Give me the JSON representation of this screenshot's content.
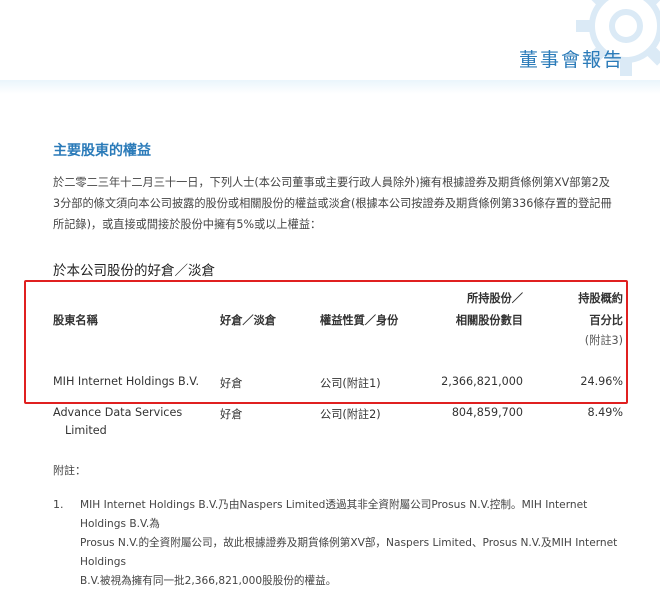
{
  "header": {
    "title": "董事會報告"
  },
  "section": {
    "title": "主要股東的權益",
    "intro_lines": [
      "於二零二三年十二月三十一日，下列人士(本公司董事或主要行政人員除外)擁有根據證券及期貨條例第XV部第2及",
      "3分部的條文須向本公司披露的股份或相關股份的權益或淡倉(根據本公司按證券及期貨條例第336條存置的登記冊",
      "所記錄)，或直接或間接於股份中擁有5%或以上權益："
    ]
  },
  "table": {
    "title": "於本公司股份的好倉／淡倉",
    "headers": {
      "name": "股東名稱",
      "position": "好倉／淡倉",
      "nature": "權益性質／身份",
      "shares_line1": "所持股份／",
      "shares_line2": "相關股份數目",
      "pct_line1": "持股概約",
      "pct_line2": "百分比",
      "pct_line3": "(附註3)"
    },
    "rows": [
      {
        "name_line1": "MIH Internet Holdings B.V.",
        "name_line2": "",
        "position": "好倉",
        "nature": "公司(附註1)",
        "shares": "2,366,821,000",
        "pct": "24.96%"
      },
      {
        "name_line1": "Advance Data Services",
        "name_line2": "Limited",
        "position": "好倉",
        "nature": "公司(附註2)",
        "shares": "804,859,700",
        "pct": "8.49%"
      }
    ]
  },
  "notes": {
    "heading": "附註：",
    "items": [
      {
        "num": "1.",
        "lines": [
          "MIH Internet Holdings B.V.乃由Naspers Limited透過其非全資附屬公司Prosus N.V.控制。MIH Internet Holdings B.V.為",
          "Prosus N.V.的全資附屬公司，故此根據證券及期貨條例第XV部，Naspers Limited、Prosus N.V.及MIH Internet Holdings",
          "B.V.被視為擁有同一批2,366,821,000股股份的權益。"
        ]
      }
    ]
  },
  "colors": {
    "accent": "#2b7bb9",
    "highlight": "#e02020"
  }
}
